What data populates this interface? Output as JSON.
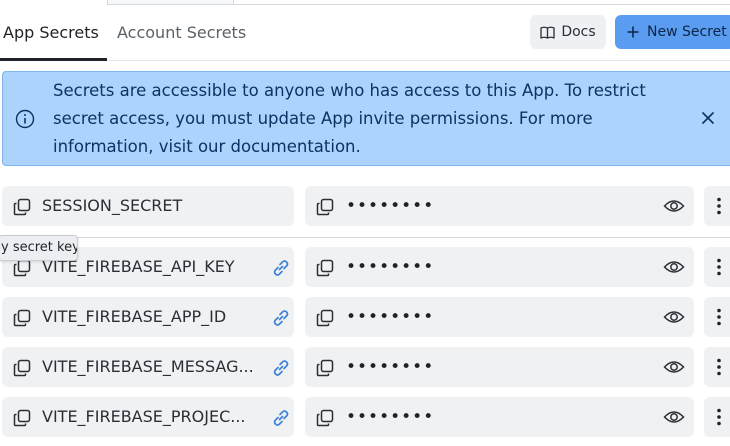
{
  "tabs": [
    {
      "label": "App Secrets",
      "active": true
    },
    {
      "label": "Account Secrets",
      "active": false
    }
  ],
  "toolbar": {
    "docs_label": "Docs",
    "new_secret_label": "New Secret"
  },
  "banner": {
    "text": "Secrets are accessible to anyone who has access to this App. To restrict secret access, you must update App invite permissions. For more information, visit our documentation."
  },
  "tooltip": {
    "text": "y secret key"
  },
  "secrets": [
    {
      "key": "SESSION_SECRET",
      "value_masked": "••••••••",
      "linked": false
    },
    {
      "key": "VITE_FIREBASE_API_KEY",
      "value_masked": "••••••••",
      "linked": true
    },
    {
      "key": "VITE_FIREBASE_APP_ID",
      "value_masked": "••••••••",
      "linked": true
    },
    {
      "key": "VITE_FIREBASE_MESSAG...",
      "value_masked": "••••••••",
      "linked": true
    },
    {
      "key": "VITE_FIREBASE_PROJEC...",
      "value_masked": "••••••••",
      "linked": true
    }
  ],
  "colors": {
    "primary_button": "#5a9cf0",
    "banner_bg": "#abd3fb",
    "link_icon": "#3d82d6"
  }
}
